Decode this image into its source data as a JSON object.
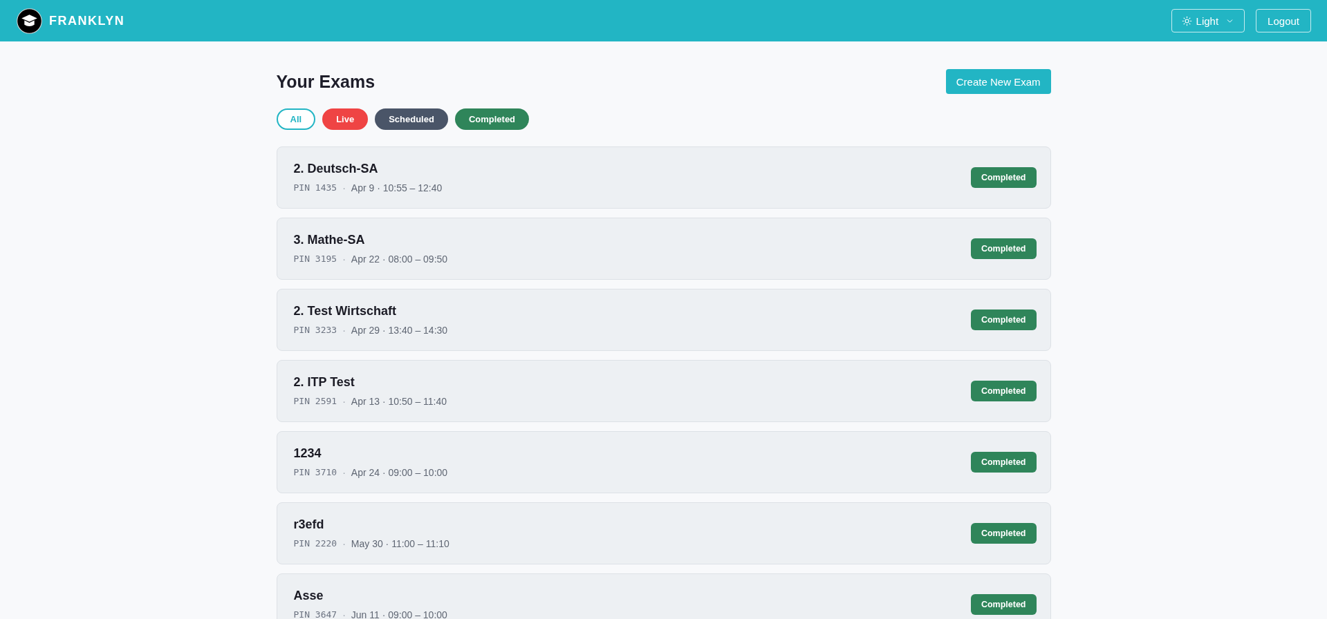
{
  "header": {
    "brand": "FRANKLYN",
    "theme_button": {
      "label": "Light"
    },
    "logout_button": {
      "label": "Logout"
    }
  },
  "page": {
    "title": "Your Exams",
    "create_button": {
      "label": "Create New Exam"
    }
  },
  "filters": [
    {
      "label": "All",
      "selected": true,
      "color": "#22b5c4"
    },
    {
      "label": "Live",
      "selected": false,
      "color": "#ef4444"
    },
    {
      "label": "Scheduled",
      "selected": false,
      "color": "#4a5568"
    },
    {
      "label": "Completed",
      "selected": false,
      "color": "#2f855a"
    }
  ],
  "exams": [
    {
      "title": "2. Deutsch-SA",
      "pin": "PIN 1435",
      "separator": "·",
      "schedule": "Apr 9 · 10:55 – 12:40",
      "status": {
        "label": "Completed",
        "color": "#2f855a"
      }
    },
    {
      "title": "3. Mathe-SA",
      "pin": "PIN 3195",
      "separator": "·",
      "schedule": "Apr 22 · 08:00 – 09:50",
      "status": {
        "label": "Completed",
        "color": "#2f855a"
      }
    },
    {
      "title": "2. Test Wirtschaft",
      "pin": "PIN 3233",
      "separator": "·",
      "schedule": "Apr 29 · 13:40 – 14:30",
      "status": {
        "label": "Completed",
        "color": "#2f855a"
      }
    },
    {
      "title": "2. ITP Test",
      "pin": "PIN 2591",
      "separator": "·",
      "schedule": "Apr 13 · 10:50 – 11:40",
      "status": {
        "label": "Completed",
        "color": "#2f855a"
      }
    },
    {
      "title": "1234",
      "pin": "PIN 3710",
      "separator": "·",
      "schedule": "Apr 24 · 09:00 – 10:00",
      "status": {
        "label": "Completed",
        "color": "#2f855a"
      }
    },
    {
      "title": "r3efd",
      "pin": "PIN 2220",
      "separator": "·",
      "schedule": "May 30 · 11:00 – 11:10",
      "status": {
        "label": "Completed",
        "color": "#2f855a"
      }
    },
    {
      "title": "Asse",
      "pin": "PIN 3647",
      "separator": "·",
      "schedule": "Jun 11 · 09:00 – 10:00",
      "status": {
        "label": "Completed",
        "color": "#2f855a"
      }
    }
  ]
}
